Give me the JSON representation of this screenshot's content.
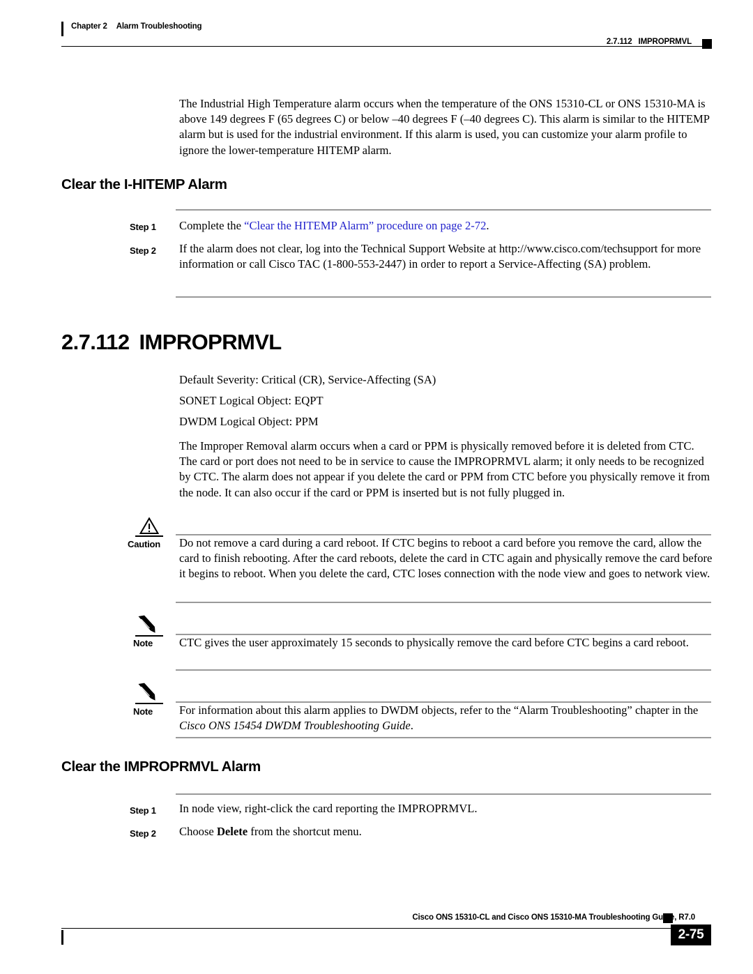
{
  "header": {
    "chapter_number": "Chapter 2",
    "chapter_title": "Alarm Troubleshooting",
    "section_number": "2.7.112",
    "section_title": "IMPROPRMVL"
  },
  "intro_paragraph": "The Industrial High Temperature alarm occurs when the temperature of the ONS 15310-CL or ONS 15310-MA is above 149 degrees F (65 degrees C) or below –40 degrees F (–40 degrees C). This alarm is similar to the HITEMP alarm but is used for the industrial environment. If this alarm is used, you can customize your alarm profile to ignore the lower-temperature HITEMP alarm.",
  "procedure_hitemp": {
    "heading": "Clear the I-HITEMP Alarm",
    "steps": [
      {
        "label": "Step 1",
        "text_before": "Complete the ",
        "link_text": "“Clear the HITEMP Alarm” procedure on page 2-72",
        "text_after": "."
      },
      {
        "label": "Step 2",
        "text": "If the alarm does not clear, log into the Technical Support Website at http://www.cisco.com/techsupport for more information or call Cisco TAC (1-800-553-2447) in order to report a Service-Affecting (SA) problem."
      }
    ]
  },
  "section": {
    "number": "2.7.112",
    "title": "IMPROPRMVL",
    "attributes": [
      "Default Severity: Critical (CR), Service-Affecting (SA)",
      "SONET Logical Object: EQPT",
      "DWDM Logical Object: PPM"
    ],
    "description": "The Improper Removal alarm occurs when a card or PPM is physically removed before it is deleted from CTC. The card or port does not need to be in service to cause the IMPROPRMVL alarm; it only needs to be recognized by CTC. The alarm does not appear if you delete the card or PPM from CTC before you physically remove it from the node. It can also occur if the card or PPM is inserted but is not fully plugged in."
  },
  "caution": {
    "label": "Caution",
    "icon": "warning-triangle-icon",
    "text": "Do not remove a card during a card reboot. If CTC begins to reboot a card before you remove the card, allow the card to finish rebooting. After the card reboots, delete the card in CTC again and physically remove the card before it begins to reboot. When you delete the card, CTC loses connection with the node view and goes to network view."
  },
  "note_1": {
    "label": "Note",
    "icon": "pencil-icon",
    "text": "CTC gives the user approximately 15 seconds to physically remove the card before CTC begins a card reboot."
  },
  "note_2": {
    "label": "Note",
    "icon": "pencil-icon",
    "text_before": "For information about this alarm applies to DWDM objects, refer to the “Alarm Troubleshooting” chapter in the ",
    "italic_text": "Cisco ONS 15454 DWDM Troubleshooting Guide",
    "text_after": "."
  },
  "procedure_improprmvl": {
    "heading": "Clear the IMPROPRMVL Alarm",
    "steps": [
      {
        "label": "Step 1",
        "text": "In node view, right-click the card reporting the IMPROPRMVL."
      },
      {
        "label": "Step 2",
        "text_before": "Choose ",
        "bold_text": "Delete",
        "text_after": " from the shortcut menu."
      }
    ]
  },
  "footer": {
    "guide_title": "Cisco ONS 15310-CL and Cisco ONS 15310-MA Troubleshooting Guide, R7.0",
    "page_number": "2-75"
  },
  "colors": {
    "link": "#2222cc",
    "rule_gray": "#9a9a9a",
    "ink": "#000000",
    "page_background": "#ffffff"
  }
}
